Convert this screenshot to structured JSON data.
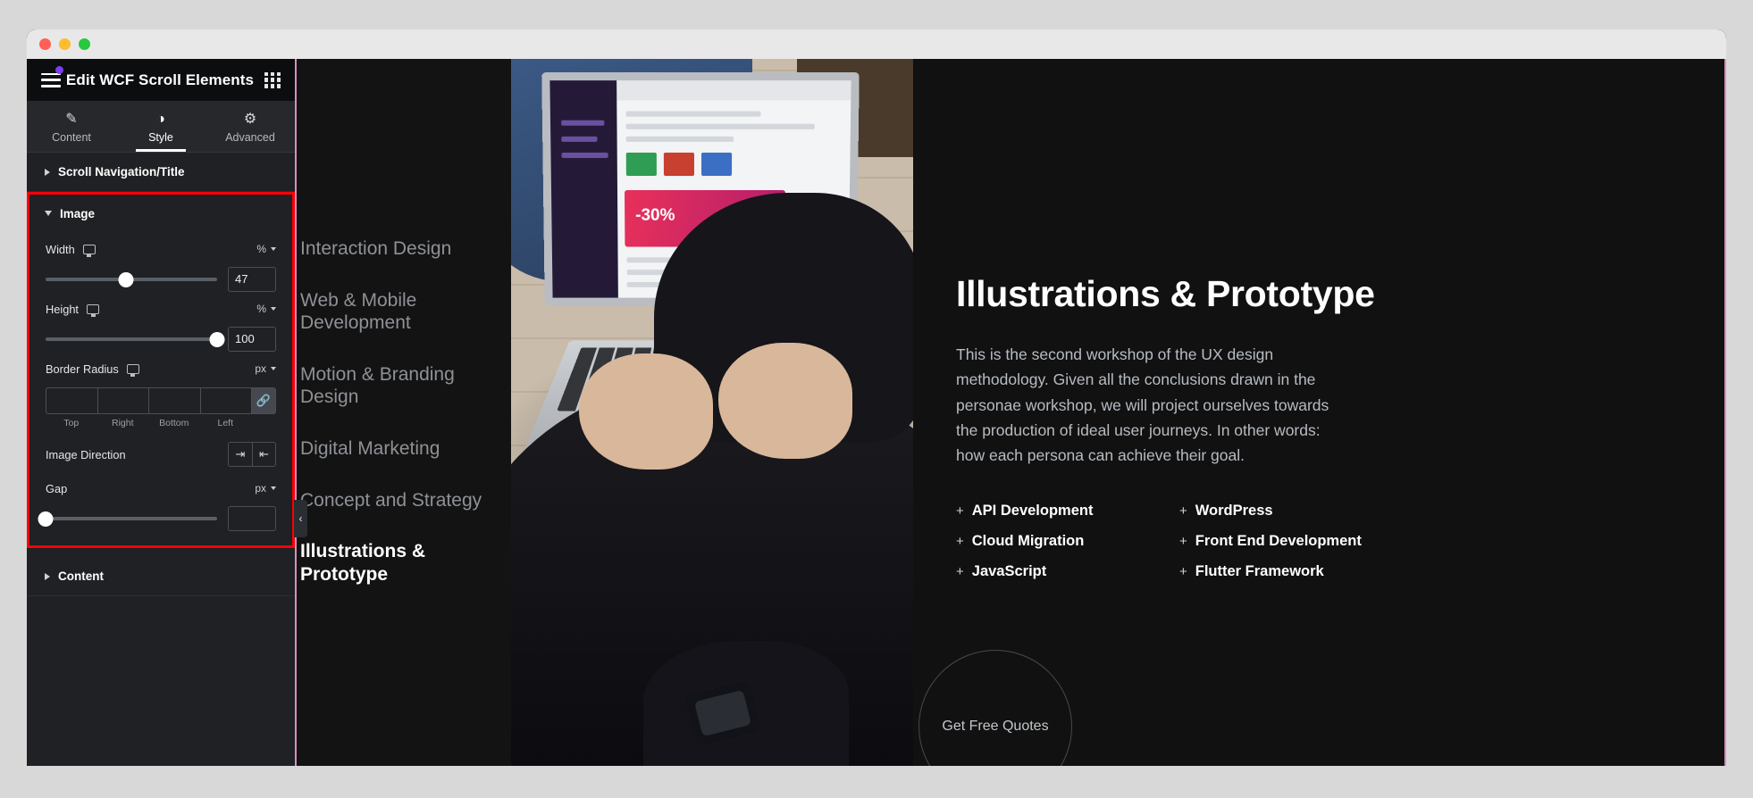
{
  "window": {
    "traffic_lights": [
      "close",
      "minimize",
      "maximize"
    ]
  },
  "panel": {
    "header": {
      "menu_icon": "hamburger-icon",
      "title": "Edit WCF Scroll Elements",
      "apps_icon": "grid-apps-icon"
    },
    "tabs": [
      {
        "id": "content",
        "label": "Content",
        "icon": "pencil-icon",
        "active": false
      },
      {
        "id": "style",
        "label": "Style",
        "icon": "contrast-icon",
        "active": true
      },
      {
        "id": "advanced",
        "label": "Advanced",
        "icon": "gear-icon",
        "active": false
      }
    ],
    "sections": [
      {
        "id": "scroll-nav-title",
        "label": "Scroll Navigation/Title",
        "expanded": false
      },
      {
        "id": "image",
        "label": "Image",
        "expanded": true,
        "highlighted": true
      },
      {
        "id": "content-section",
        "label": "Content",
        "expanded": false
      }
    ],
    "image_controls": {
      "width": {
        "label": "Width",
        "device_icon": "desktop-icon",
        "unit": "%",
        "value": "47",
        "slider_percent": 47
      },
      "height": {
        "label": "Height",
        "device_icon": "desktop-icon",
        "unit": "%",
        "value": "100",
        "slider_percent": 100
      },
      "border_radius": {
        "label": "Border Radius",
        "device_icon": "desktop-icon",
        "unit": "px",
        "values": [
          "",
          "",
          "",
          ""
        ],
        "side_labels": [
          "Top",
          "Right",
          "Bottom",
          "Left"
        ],
        "link_icon": "link-icon",
        "linked": true
      },
      "image_direction": {
        "label": "Image Direction",
        "options": [
          {
            "id": "right",
            "icon": "align-to-right-icon",
            "glyph": "⇥",
            "active": false
          },
          {
            "id": "left",
            "icon": "align-to-left-icon",
            "glyph": "⇤",
            "active": false
          }
        ]
      },
      "gap": {
        "label": "Gap",
        "unit": "px",
        "value": "",
        "slider_percent": 0
      }
    },
    "collapse_handle": {
      "icon": "chevron-left-icon",
      "glyph": "‹"
    }
  },
  "preview": {
    "nav_items": [
      {
        "label": "Interaction Design",
        "active": false
      },
      {
        "label": "Web & Mobile Development",
        "active": false
      },
      {
        "label": "Motion & Branding Design",
        "active": false
      },
      {
        "label": "Digital Marketing",
        "active": false
      },
      {
        "label": "Concept and Strategy",
        "active": false
      },
      {
        "label": "Illustrations & Prototype",
        "active": true
      }
    ],
    "content": {
      "title": "Illustrations & Prototype",
      "paragraph": "This is the second workshop of the UX design methodology. Given all the conclusions drawn in the personae workshop, we will project ourselves towards the production of ideal user journeys. In other words: how each persona can achieve their goal.",
      "features": [
        "API Development",
        "WordPress",
        "Cloud Migration",
        "Front End Development",
        "JavaScript",
        "Flutter Framework"
      ],
      "feature_bullet": "+",
      "cta": "Get Free Quotes"
    },
    "image_alt": "person-using-laptop-photo"
  },
  "colors": {
    "highlight_border": "#fb0007",
    "accent_purple": "#7a3ff0",
    "guide_pink": "#d98ec0",
    "panel_bg": "#1f2124",
    "preview_bg": "#111111"
  }
}
